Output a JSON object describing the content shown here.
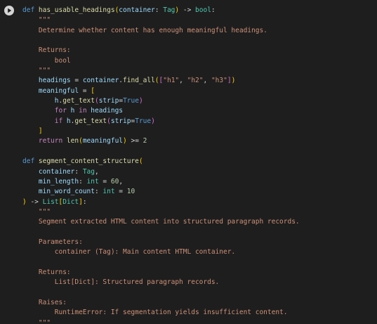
{
  "cell": {
    "run_icon": "play-icon",
    "lines": [
      [
        [
          "kw",
          "def "
        ],
        [
          "fn",
          "has_usable_headings"
        ],
        [
          "br1",
          "("
        ],
        [
          "var",
          "container"
        ],
        [
          "pl",
          ": "
        ],
        [
          "ty",
          "Tag"
        ],
        [
          "br1",
          ")"
        ],
        [
          "pl",
          " -> "
        ],
        [
          "ty",
          "bool"
        ],
        [
          "pl",
          ":"
        ]
      ],
      [
        [
          "str",
          "    \"\"\""
        ]
      ],
      [
        [
          "str",
          "    Determine whether content has enough meaningful headings."
        ]
      ],
      [],
      [
        [
          "str",
          "    Returns:"
        ]
      ],
      [
        [
          "str",
          "        bool"
        ]
      ],
      [
        [
          "str",
          "    \"\"\""
        ]
      ],
      [
        [
          "var",
          "    headings"
        ],
        [
          "pl",
          " = "
        ],
        [
          "var",
          "container"
        ],
        [
          "pl",
          "."
        ],
        [
          "fn",
          "find_all"
        ],
        [
          "br1",
          "("
        ],
        [
          "br2",
          "["
        ],
        [
          "str",
          "\"h1\""
        ],
        [
          "pl",
          ", "
        ],
        [
          "str",
          "\"h2\""
        ],
        [
          "pl",
          ", "
        ],
        [
          "str",
          "\"h3\""
        ],
        [
          "br2",
          "]"
        ],
        [
          "br1",
          ")"
        ]
      ],
      [
        [
          "var",
          "    meaningful"
        ],
        [
          "pl",
          " = "
        ],
        [
          "br1",
          "["
        ]
      ],
      [
        [
          "var",
          "        h"
        ],
        [
          "pl",
          "."
        ],
        [
          "fn",
          "get_text"
        ],
        [
          "br2",
          "("
        ],
        [
          "var",
          "strip"
        ],
        [
          "pl",
          "="
        ],
        [
          "kw",
          "True"
        ],
        [
          "br2",
          ")"
        ]
      ],
      [
        [
          "ctl",
          "        for "
        ],
        [
          "var",
          "h"
        ],
        [
          "ctl",
          " in "
        ],
        [
          "var",
          "headings"
        ]
      ],
      [
        [
          "ctl",
          "        if "
        ],
        [
          "var",
          "h"
        ],
        [
          "pl",
          "."
        ],
        [
          "fn",
          "get_text"
        ],
        [
          "br2",
          "("
        ],
        [
          "var",
          "strip"
        ],
        [
          "pl",
          "="
        ],
        [
          "kw",
          "True"
        ],
        [
          "br2",
          ")"
        ]
      ],
      [
        [
          "br1",
          "    ]"
        ]
      ],
      [
        [
          "ctl",
          "    return "
        ],
        [
          "fn",
          "len"
        ],
        [
          "br1",
          "("
        ],
        [
          "var",
          "meaningful"
        ],
        [
          "br1",
          ")"
        ],
        [
          "pl",
          " >= "
        ],
        [
          "num",
          "2"
        ]
      ],
      [],
      [
        [
          "kw",
          "def "
        ],
        [
          "fn",
          "segment_content_structure"
        ],
        [
          "br1",
          "("
        ]
      ],
      [
        [
          "var",
          "    container"
        ],
        [
          "pl",
          ": "
        ],
        [
          "ty",
          "Tag"
        ],
        [
          "pl",
          ","
        ]
      ],
      [
        [
          "var",
          "    min_length"
        ],
        [
          "pl",
          ": "
        ],
        [
          "ty",
          "int"
        ],
        [
          "pl",
          " = "
        ],
        [
          "num",
          "60"
        ],
        [
          "pl",
          ","
        ]
      ],
      [
        [
          "var",
          "    min_word_count"
        ],
        [
          "pl",
          ": "
        ],
        [
          "ty",
          "int"
        ],
        [
          "pl",
          " = "
        ],
        [
          "num",
          "10"
        ]
      ],
      [
        [
          "br1",
          ")"
        ],
        [
          "pl",
          " -> "
        ],
        [
          "ty",
          "List"
        ],
        [
          "br1",
          "["
        ],
        [
          "ty",
          "Dict"
        ],
        [
          "br1",
          "]"
        ],
        [
          "pl",
          ":"
        ]
      ],
      [
        [
          "str",
          "    \"\"\""
        ]
      ],
      [
        [
          "str",
          "    Segment extracted HTML content into structured paragraph records."
        ]
      ],
      [],
      [
        [
          "str",
          "    Parameters:"
        ]
      ],
      [
        [
          "str",
          "        container (Tag): Main content HTML container."
        ]
      ],
      [],
      [
        [
          "str",
          "    Returns:"
        ]
      ],
      [
        [
          "str",
          "        List[Dict]: Structured paragraph records."
        ]
      ],
      [],
      [
        [
          "str",
          "    Raises:"
        ]
      ],
      [
        [
          "str",
          "        RuntimeError: If segmentation yields insufficient content."
        ]
      ],
      [
        [
          "str",
          "    \"\"\""
        ]
      ]
    ]
  }
}
